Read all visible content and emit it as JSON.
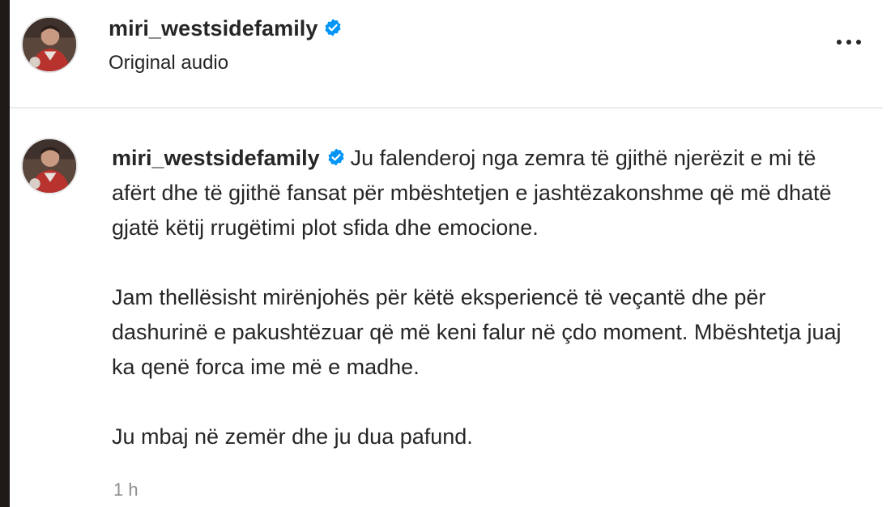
{
  "post": {
    "username": "miri_westsidefamily",
    "audio_label": "Original audio",
    "verified_icon": "verified-badge-icon",
    "more_icon": "more-options-icon"
  },
  "caption": {
    "username": "miri_westsidefamily",
    "paragraph_1": "Ju falenderoj nga zemra të gjithë njerëzit e mi të afërt dhe të gjithë fansat për mbështetjen e jashtëzakonshme që më dhatë gjatë këtij rrugëtimi plot sfida dhe emocione.",
    "paragraph_2": "Jam thellësisht mirënjohës për këtë eksperiencë të veçantë dhe për dashurinë e pakushtëzuar që më keni falur në çdo moment. Mbështetja juaj ka qenë forca ime më e madhe.",
    "paragraph_3": "Ju mbaj në zemër dhe ju dua pafund.",
    "timestamp": "1 h"
  },
  "colors": {
    "verified_blue": "#0095f6",
    "text_primary": "#262626",
    "text_secondary": "#8e8e8e",
    "divider": "#ececec"
  }
}
